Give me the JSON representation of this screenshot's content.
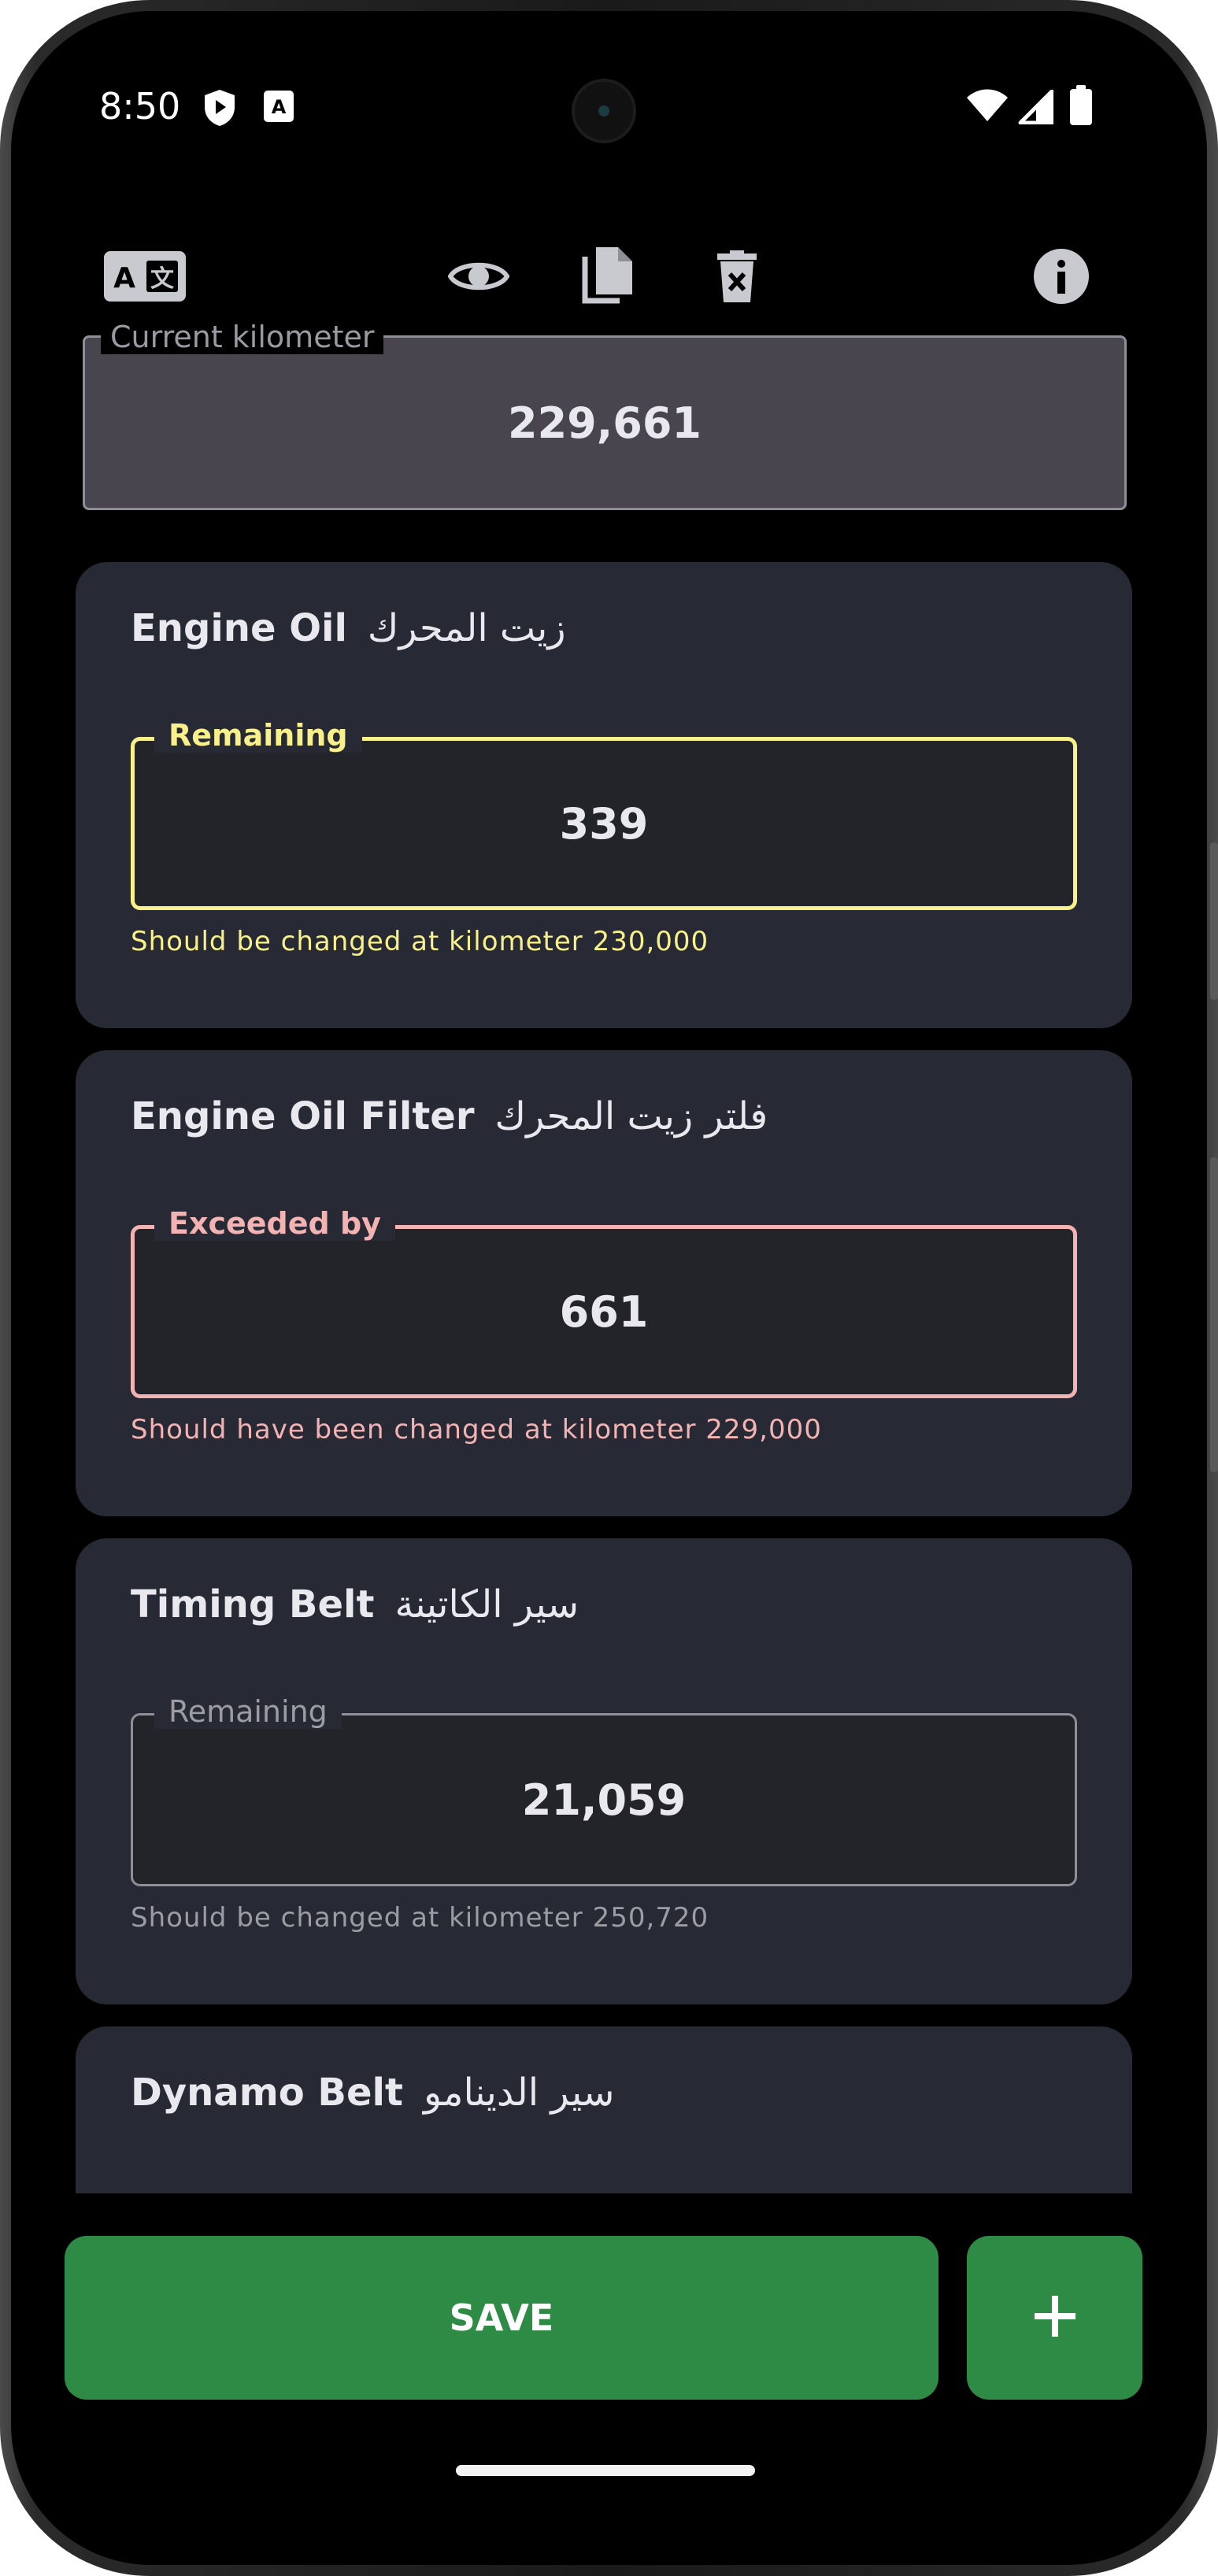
{
  "status_bar": {
    "time": "8:50",
    "icons": [
      "play-protect-icon",
      "keyboard-a-icon",
      "wifi-icon",
      "signal-icon",
      "battery-icon"
    ]
  },
  "toolbar": {
    "icons": [
      "translate-icon",
      "eye-icon",
      "copy-icon",
      "delete-icon",
      "info-icon"
    ]
  },
  "current_km": {
    "label": "Current kilometer",
    "value": "229,661"
  },
  "items": [
    {
      "title": "Engine Oil",
      "title_ar": "زيت المحرك",
      "field_label": "Remaining",
      "value": "339",
      "helper": "Should be changed at kilometer 230,000",
      "status_color": "#f8f08a"
    },
    {
      "title": "Engine Oil Filter",
      "title_ar": "فلتر زيت المحرك",
      "field_label": "Exceeded by",
      "value": "661",
      "helper": "Should have been changed at kilometer 229,000",
      "status_color": "#f4b3b3"
    },
    {
      "title": "Timing Belt",
      "title_ar": "سير الكاتينة",
      "field_label": "Remaining",
      "value": "21,059",
      "helper": "Should be changed at kilometer 250,720",
      "status_color": "#9b9ca4"
    },
    {
      "title": "Dynamo Belt",
      "title_ar": "سير الدينامو"
    }
  ],
  "actions": {
    "save_label": "SAVE",
    "add_label": "+"
  },
  "colors": {
    "accent_green": "#2e8b45",
    "card_bg": "#272a35",
    "warning": "#f8f08a",
    "danger": "#f4b3b3"
  }
}
